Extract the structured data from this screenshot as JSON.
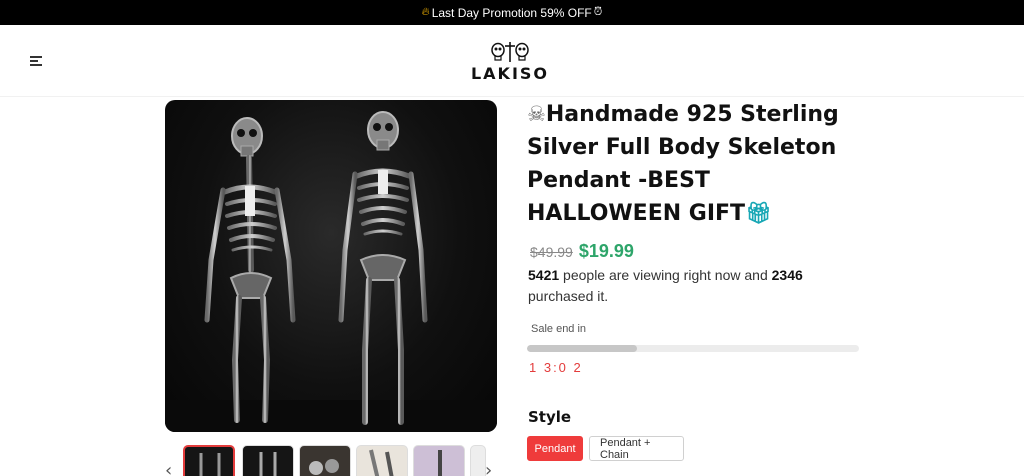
{
  "promo": {
    "icon": "flame-icon",
    "text": "Last Day Promotion 59% OFF",
    "trailing_icon": "alarm-clock-icon"
  },
  "header": {
    "brand": "LAKISO",
    "menu_icon": "hamburger-menu-icon"
  },
  "product": {
    "title_prefix_icon": "skull-emoji",
    "title": "Handmade 925 Sterling Silver Full Body Skeleton Pendant -BEST HALLOWEEN GIFT",
    "title_suffix_icon": "gift-emoji",
    "old_price": "$49.99",
    "new_price": "$19.99",
    "viewing_count": "5421",
    "viewing_text": " people are viewing right now and ",
    "purchased_count": "2346",
    "purchased_text": " purchased it."
  },
  "sale": {
    "label": "Sale end in",
    "progress": 0.33,
    "timer": "1 3:0 2"
  },
  "style": {
    "label": "Style",
    "options": [
      {
        "label": "Pendant",
        "selected": true
      },
      {
        "label": "Pendant + Chain",
        "selected": false
      }
    ]
  },
  "thumbnails": {
    "count": 6,
    "active_index": 0
  },
  "colors": {
    "promo_bg": "#000000",
    "price_green": "#2ea56a",
    "accent_red": "#ef3b3b",
    "timer_red": "#e33c3c"
  }
}
